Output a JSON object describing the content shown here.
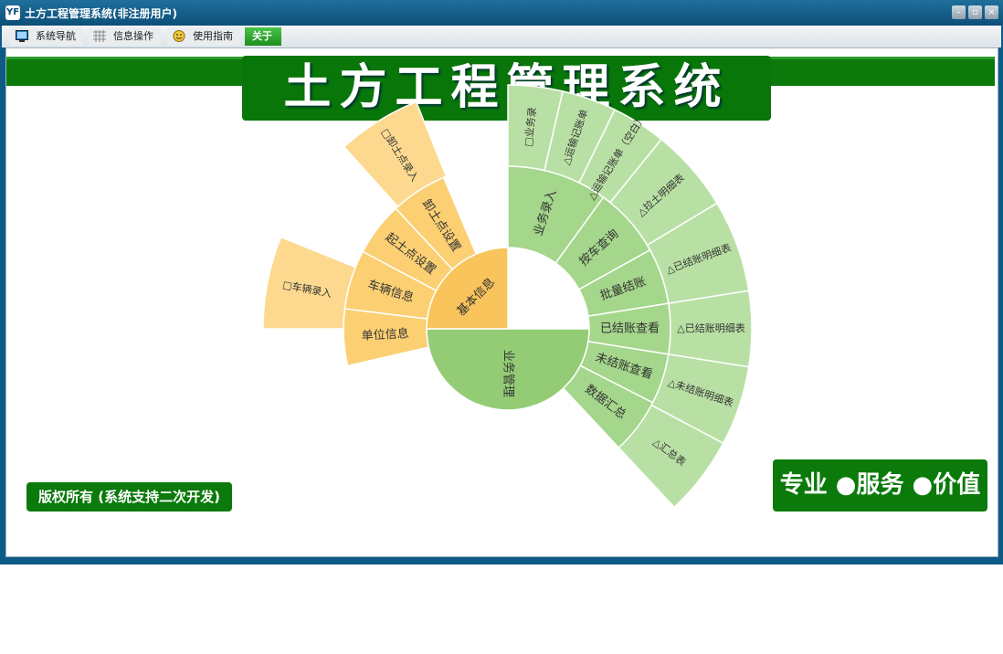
{
  "window": {
    "title": "土方工程管理系统(非注册用户)",
    "app_icon": "YF"
  },
  "tabs": {
    "nav": "系统导航",
    "info": "信息操作",
    "guide": "使用指南",
    "about": "关于"
  },
  "banner": {
    "title": "土方工程管理系统"
  },
  "footer": {
    "copyright": "版权所有 (系统支持二次开发)",
    "slogan": "专业 ●服务 ●价值"
  },
  "colors": {
    "green_inner": "#93cc75",
    "green_mid": "#a4d68b",
    "green_outer": "#b9e0a4",
    "orange_inner": "#f8c45b",
    "orange_mid": "#fbcf72",
    "orange_outer": "#fcd98f"
  },
  "sunburst": {
    "root": [
      {
        "label": "业务管理",
        "color": "green_inner"
      },
      {
        "label": "基本信息",
        "color": "orange_inner"
      }
    ],
    "green_mid": [
      {
        "label": "业务录入"
      },
      {
        "label": "按车查询"
      },
      {
        "label": "批量结账"
      },
      {
        "label": "已结账查看"
      },
      {
        "label": "未结账查看"
      },
      {
        "label": "数据汇总"
      }
    ],
    "green_outer": [
      {
        "label": "□业务录"
      },
      {
        "label": "△运输记账单"
      },
      {
        "label": "△运输记账单（空白）"
      },
      {
        "label": "△拉土明细表"
      },
      {
        "label": "△已结账明细表"
      },
      {
        "label": "△已结账明细表"
      },
      {
        "label": "△未结账明细表"
      },
      {
        "label": "△汇总表"
      }
    ],
    "orange_mid": [
      {
        "label": "卸土点设置"
      },
      {
        "label": "起土点设置"
      },
      {
        "label": "车辆信息"
      },
      {
        "label": "单位信息"
      }
    ],
    "orange_outer": [
      {
        "label": "□卸土点录入"
      },
      {
        "label": "□车辆录入"
      }
    ]
  }
}
